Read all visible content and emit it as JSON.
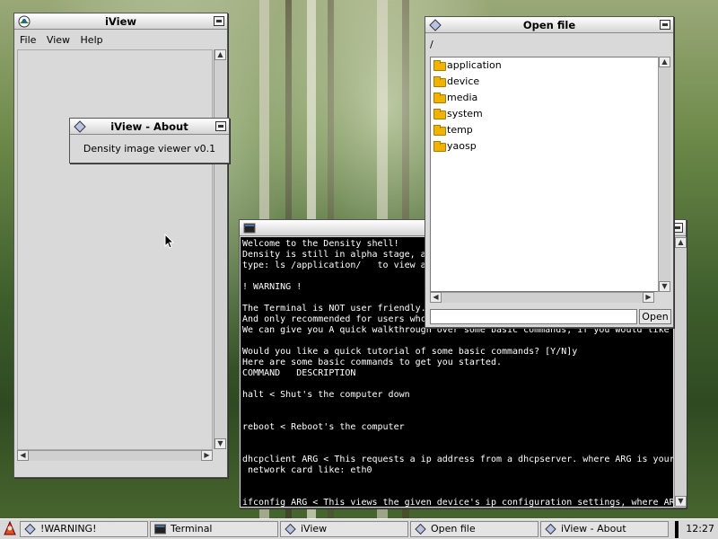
{
  "iview": {
    "title": "iView",
    "menu": [
      "File",
      "View",
      "Help"
    ]
  },
  "about": {
    "title": "iView - About",
    "text": "Density image viewer v0.1"
  },
  "terminal": {
    "lines": [
      "Welcome to the Density shell!",
      "Density is still in alpha stage, a",
      "type: ls /application/   to view a",
      "",
      "! WARNING !",
      "",
      "The Terminal is NOT user friendly.",
      "And only recommended for users whc",
      "We can give you A quick walkthrough over some basic commands, if you would like",
      "",
      "Would you like a quick tutorial of some basic commands? [Y/N]y",
      "Here are some basic commands to get you started.",
      "COMMAND   DESCRIPTION",
      "",
      "halt < Shut's the computer down",
      "",
      "",
      "reboot < Reboot's the computer",
      "",
      "",
      "dhcpclient ARG < This requests a ip address from a dhcpserver. where ARG is your",
      " network card like: eth0",
      "",
      "",
      "ifconfig ARG < This views the given device's ip configuration settings, where AR"
    ]
  },
  "openfile": {
    "title": "Open file",
    "path": "/",
    "items": [
      "application",
      "device",
      "media",
      "system",
      "temp",
      "yaosp"
    ],
    "filename_value": "",
    "open_label": "Open"
  },
  "taskbar": {
    "tasks": [
      "!WARNING!",
      "Terminal",
      "iView",
      "Open file",
      "iView - About"
    ],
    "clock": "12:27"
  }
}
